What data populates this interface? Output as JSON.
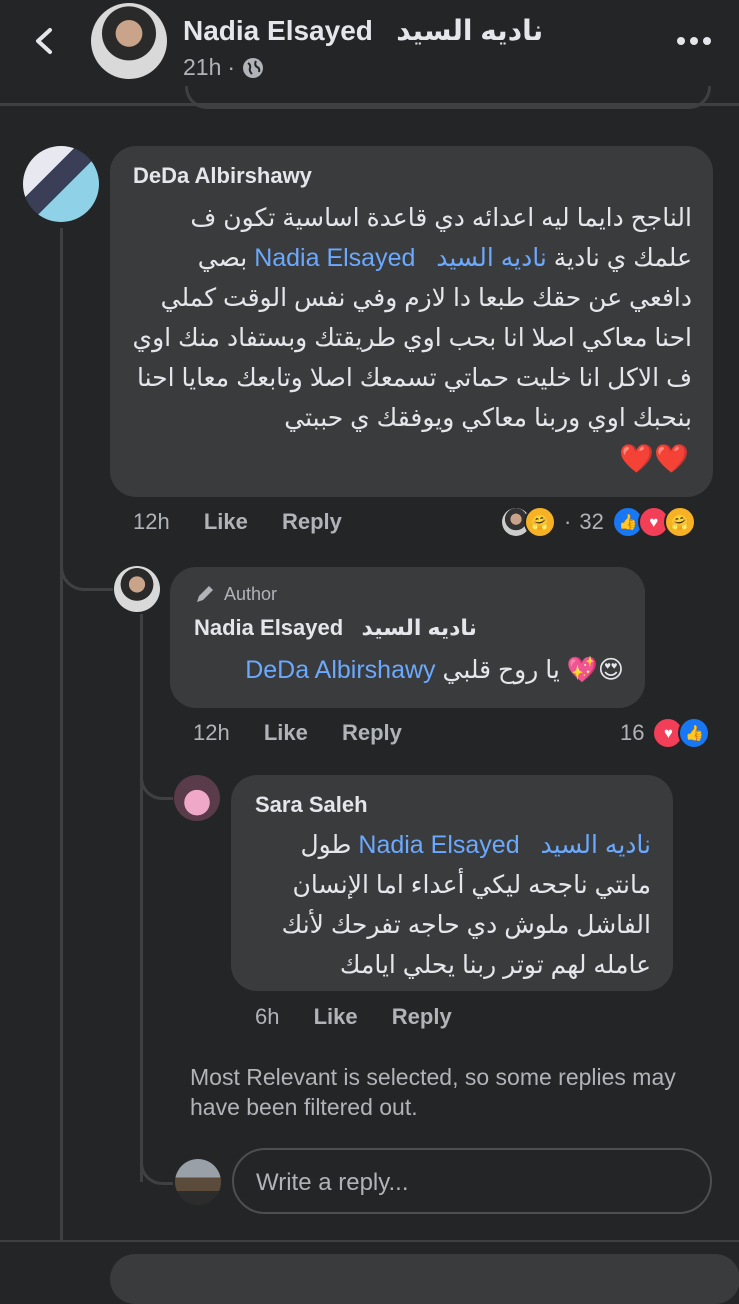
{
  "header": {
    "back_icon": "chevron-left-icon",
    "author_name": "Nadia Elsayed   ناديه السيد",
    "time": "21h",
    "privacy_icon": "globe-icon",
    "more_icon": "more-icon"
  },
  "comments": [
    {
      "author": "DeDa Albirshawy",
      "text_before_mention": "الناجح دايما ليه اعدائه دي قاعدة اساسية تكون ف علمك ي نادية ",
      "mention": "ناديه السيد   Nadia Elsayed",
      "text_after_mention": " بصي دافعي عن حقك طبعا دا لازم وفي نفس الوقت كملي احنا معاكي اصلا انا بحب اوي طريقتك وبستفاد منك اوي ف الاكل انا خليت حماتي تسمعك اصلا وتابعك معايا احنا بنحبك اوي وربنا معاكي ويوفقك ي حببتي",
      "emoji": "❤️❤️",
      "time": "12h",
      "like": "Like",
      "reply": "Reply",
      "reaction_count": "32"
    },
    {
      "badge": "Author",
      "author": "Nadia Elsayed   ناديه السيد",
      "mention": "DeDa Albirshawy",
      "text": " يا روح قلبي ",
      "emoji": "😍💖",
      "time": "12h",
      "like": "Like",
      "reply": "Reply",
      "reaction_count": "16"
    },
    {
      "author": "Sara Saleh",
      "mention": "ناديه السيد   Nadia Elsayed",
      "text": " طول مانتي ناجحه ليكي أعداء اما الإنسان الفاشل ملوش دي حاجه تفرحك لأنك عامله لهم توتر ربنا يحلي ايامك",
      "time": "6h",
      "like": "Like",
      "reply": "Reply"
    }
  ],
  "filter_notice": "Most Relevant is selected, so some replies may have been filtered out.",
  "reply_box": {
    "placeholder": "Write a reply..."
  },
  "colors": {
    "background": "#242526",
    "bubble": "#3a3b3c",
    "mention": "#6ba9ff",
    "like_blue": "#1877f2",
    "love_red": "#f33e58"
  }
}
